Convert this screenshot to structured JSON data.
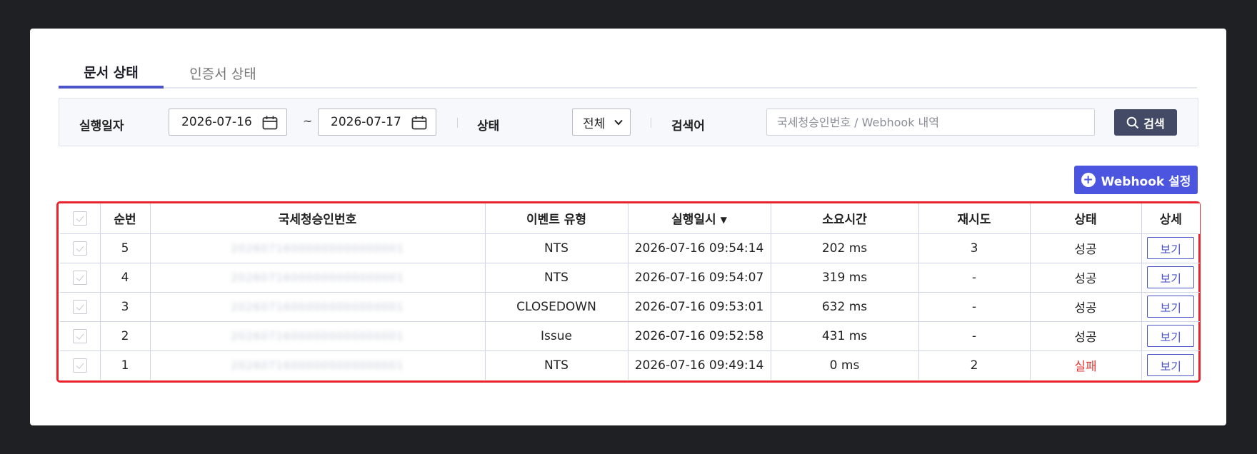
{
  "tabs": [
    {
      "label": "문서 상태",
      "active": true
    },
    {
      "label": "인증서 상태",
      "active": false
    }
  ],
  "filter": {
    "date_label": "실행일자",
    "date_from": "2026-07-16",
    "date_to": "2026-07-17",
    "tilde": "~",
    "status_label": "상태",
    "status_value": "전체",
    "keyword_label": "검색어",
    "keyword_placeholder": "국세청승인번호 / Webhook 내역",
    "search_label": "검색"
  },
  "webhook_button_label": "Webhook 설정",
  "table": {
    "headers": {
      "seq": "순번",
      "approval_no": "국세청승인번호",
      "event_type": "이벤트 유형",
      "exec_time": "실행일시",
      "duration": "소요시간",
      "retry": "재시도",
      "status": "상태",
      "detail": "상세"
    },
    "sort_indicator": "▼",
    "view_label": "보기",
    "rows": [
      {
        "seq": "5",
        "approval_no": "20260716000000000000001",
        "event_type": "NTS",
        "exec_time": "2026-07-16 09:54:14",
        "duration": "202 ms",
        "retry": "3",
        "status": "성공"
      },
      {
        "seq": "4",
        "approval_no": "20260716000000000000001",
        "event_type": "NTS",
        "exec_time": "2026-07-16 09:54:07",
        "duration": "319 ms",
        "retry": "-",
        "status": "성공"
      },
      {
        "seq": "3",
        "approval_no": "20260716000000000000001",
        "event_type": "CLOSEDOWN",
        "exec_time": "2026-07-16 09:53:01",
        "duration": "632 ms",
        "retry": "-",
        "status": "성공"
      },
      {
        "seq": "2",
        "approval_no": "20260716000000000000001",
        "event_type": "Issue",
        "exec_time": "2026-07-16 09:52:58",
        "duration": "431 ms",
        "retry": "-",
        "status": "성공"
      },
      {
        "seq": "1",
        "approval_no": "20260716000000000000001",
        "event_type": "NTS",
        "exec_time": "2026-07-16 09:49:14",
        "duration": "0 ms",
        "retry": "2",
        "status": "실패"
      }
    ]
  },
  "colors": {
    "accent": "#4b55e0",
    "search_button": "#434a66",
    "highlight_border": "#e8232d",
    "fail_text": "#e23b3b"
  }
}
